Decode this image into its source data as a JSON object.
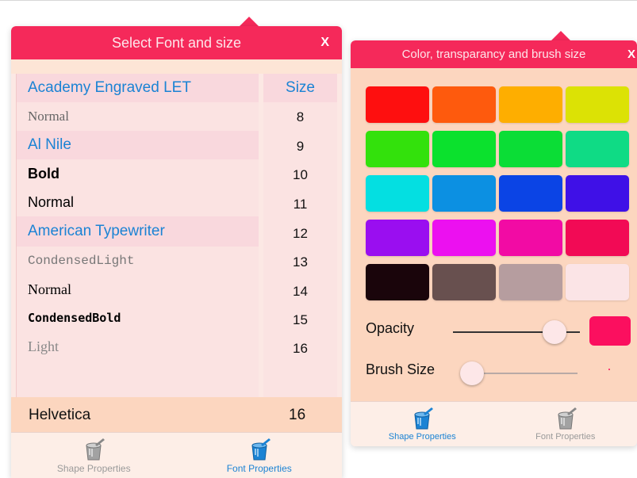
{
  "font_panel": {
    "title": "Select Font and size",
    "close_label": "X",
    "fonts": [
      {
        "label": "Academy Engraved LET",
        "kind": "family"
      },
      {
        "label": "Normal",
        "kind": "style",
        "css": "serif-normal"
      },
      {
        "label": "Al Nile",
        "kind": "family"
      },
      {
        "label": "Bold",
        "kind": "style",
        "css": "sans-bold"
      },
      {
        "label": "Normal",
        "kind": "style",
        "css": "sans-normal"
      },
      {
        "label": "American Typewriter",
        "kind": "family"
      },
      {
        "label": "CondensedLight",
        "kind": "style",
        "css": "mono-light"
      },
      {
        "label": "Normal",
        "kind": "style",
        "css": "mono-normal"
      },
      {
        "label": "CondensedBold",
        "kind": "style",
        "css": "mono-bold"
      },
      {
        "label": "Light",
        "kind": "style",
        "css": "mono-light"
      }
    ],
    "size_header": "Size",
    "sizes": [
      "8",
      "9",
      "10",
      "11",
      "12",
      "13",
      "14",
      "15",
      "16"
    ],
    "selected_font": "Helvetica",
    "selected_size": "16",
    "tabs": [
      {
        "label": "Shape Properties",
        "icon": "paint-bucket-icon",
        "active": false
      },
      {
        "label": "Font Properties",
        "icon": "paint-bucket-icon",
        "active": true
      }
    ]
  },
  "color_panel": {
    "title": "Color, transparancy and brush size",
    "close_label": "X",
    "swatches": [
      "#fe0f0f",
      "#fe5a0d",
      "#feae00",
      "#dce205",
      "#33e10c",
      "#0be12d",
      "#0bdd36",
      "#0fdb85",
      "#04dfe1",
      "#0c90e2",
      "#0b44e5",
      "#3f10e7",
      "#9a0ef0",
      "#ec10f0",
      "#f20ba4",
      "#f20a55",
      "#1a050b",
      "#68504f",
      "#b69d9f",
      "#fbe4e6"
    ],
    "opacity_label": "Opacity",
    "opacity_value": 0.8,
    "brush_label": "Brush Size",
    "brush_value": 0.05,
    "current_color": "#fb0f5f",
    "tabs": [
      {
        "label": "Shape Properties",
        "icon": "paint-bucket-icon",
        "active": true
      },
      {
        "label": "Font Properties",
        "icon": "paint-bucket-icon",
        "active": false
      }
    ]
  },
  "colors": {
    "header": "#f5295a",
    "accent_blue": "#1b83d4"
  }
}
